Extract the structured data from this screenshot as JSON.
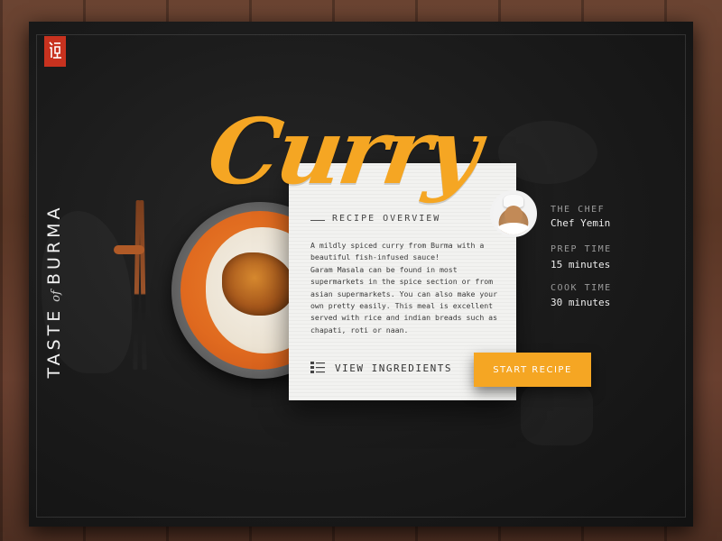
{
  "brand": {
    "side_title_a": "TASTE",
    "side_title_of": "of",
    "side_title_b": "BURMA",
    "logo_color": "#c8321f"
  },
  "recipe": {
    "name": "Curry",
    "overview_title": "RECIPE OVERVIEW",
    "description": [
      "A mildly spiced curry from Burma with a beautiful fish-infused sauce!",
      "Garam Masala can be found in most supermarkets in the spice section or from asian supermarkets. You can also make your own pretty easily. This meal is excellent served with rice and indian breads such as chapati, roti or naan."
    ],
    "view_ingredients_label": "VIEW INGREDIENTS",
    "start_label": "START RECIPE"
  },
  "info": {
    "chef_label": "THE CHEF",
    "chef_value": "Chef Yemin",
    "prep_label": "PREP TIME",
    "prep_value": "15 minutes",
    "cook_label": "COOK TIME",
    "cook_value": "30 minutes"
  },
  "colors": {
    "accent": "#f5a623",
    "board": "#1a1a1a",
    "card": "#f2f2f0"
  }
}
